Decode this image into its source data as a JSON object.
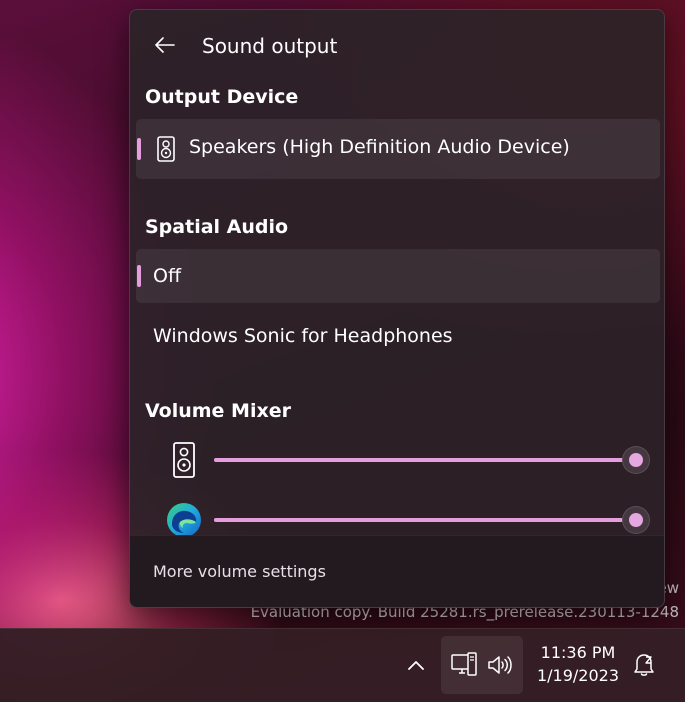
{
  "watermark": {
    "line1": "ew",
    "line2": "Evaluation copy. Build 25281.rs_prerelease.230113-1248"
  },
  "flyout": {
    "title": "Sound output",
    "output_device": {
      "heading": "Output Device",
      "selected": "Speakers (High Definition Audio Device)"
    },
    "spatial_audio": {
      "heading": "Spatial Audio",
      "options": [
        "Off",
        "Windows Sonic for Headphones"
      ],
      "selected": "Off"
    },
    "volume_mixer": {
      "heading": "Volume Mixer",
      "rows": [
        {
          "icon": "speaker-icon",
          "level": 1.0
        },
        {
          "icon": "edge-browser-icon",
          "level": 1.0
        }
      ]
    },
    "footer_link": "More volume settings"
  },
  "taskbar": {
    "time": "11:36 PM",
    "date": "1/19/2023"
  },
  "colors": {
    "accent": "#e49ddd",
    "panel_bg": "#2c2228"
  }
}
